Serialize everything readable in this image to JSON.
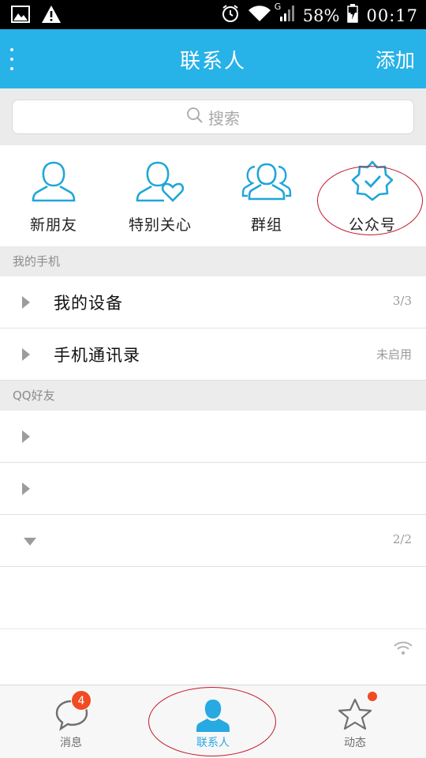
{
  "status_bar": {
    "icons_left": [
      "image-icon",
      "warning-icon"
    ],
    "network": "G",
    "battery": "58%",
    "time": "00:17"
  },
  "title_bar": {
    "title": "联系人",
    "add_label": "添加"
  },
  "search": {
    "placeholder": "搜索"
  },
  "shortcuts": [
    {
      "label": "新朋友",
      "icon": "new-friend-icon"
    },
    {
      "label": "特别关心",
      "icon": "special-care-icon"
    },
    {
      "label": "群组",
      "icon": "group-icon"
    },
    {
      "label": "公众号",
      "icon": "official-account-icon"
    }
  ],
  "my_phone": {
    "header": "我的手机",
    "items": [
      {
        "label": "我的设备",
        "count": "3/3"
      },
      {
        "label": "手机通讯录",
        "count": "未启用"
      }
    ]
  },
  "qq_friends": {
    "header": "QQ好友",
    "expanded_group_count": "2/2"
  },
  "bottom_nav": [
    {
      "label": "消息",
      "badge": "4"
    },
    {
      "label": "联系人"
    },
    {
      "label": "动态"
    }
  ],
  "colors": {
    "accent": "#27b2e8",
    "active_tab": "#27a9e1",
    "badge": "#f04b23",
    "annotation": "#c4172b"
  }
}
